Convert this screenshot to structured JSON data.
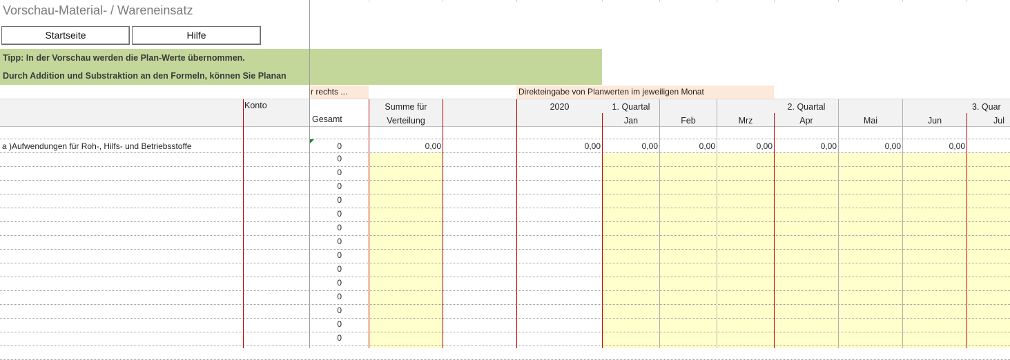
{
  "title": "Vorschau-Material- / Wareneinsatz",
  "buttons": {
    "start": "Startseite",
    "help": "Hilfe"
  },
  "tips": [
    "Tipp: In der Vorschau werden die Plan-Werte übernommen.",
    "Durch Addition und Substraktion an den Formeln, können Sie Planan"
  ],
  "notes": {
    "left_truncated": "r rechts ...",
    "direct": "Direkteingabe von Planwerten im jeweiligen Monat"
  },
  "headers": {
    "konto": "Konto",
    "gesamt": "Gesamt",
    "summe1": "Summe für",
    "summe2": "Verteilung",
    "year": "2020",
    "q1": "1. Quartal",
    "q2": "2. Quartal",
    "q3": "3. Quar",
    "months": [
      "Jan",
      "Feb",
      "Mrz",
      "Apr",
      "Mai",
      "Jun",
      "Jul"
    ]
  },
  "first_row": {
    "label": "a )Aufwendungen für Roh-, Hilfs- und Betriebsstoffe",
    "gesamt": "0",
    "summe": "0,00",
    "year": "0,00",
    "months": [
      "0,00",
      "0,00",
      "0,00",
      "0,00",
      "0,00",
      "0,00"
    ]
  },
  "gesamt_column": [
    "0",
    "0",
    "0",
    "0",
    "0",
    "0",
    "0",
    "0",
    "0",
    "0",
    "0",
    "0",
    "0",
    "0"
  ]
}
